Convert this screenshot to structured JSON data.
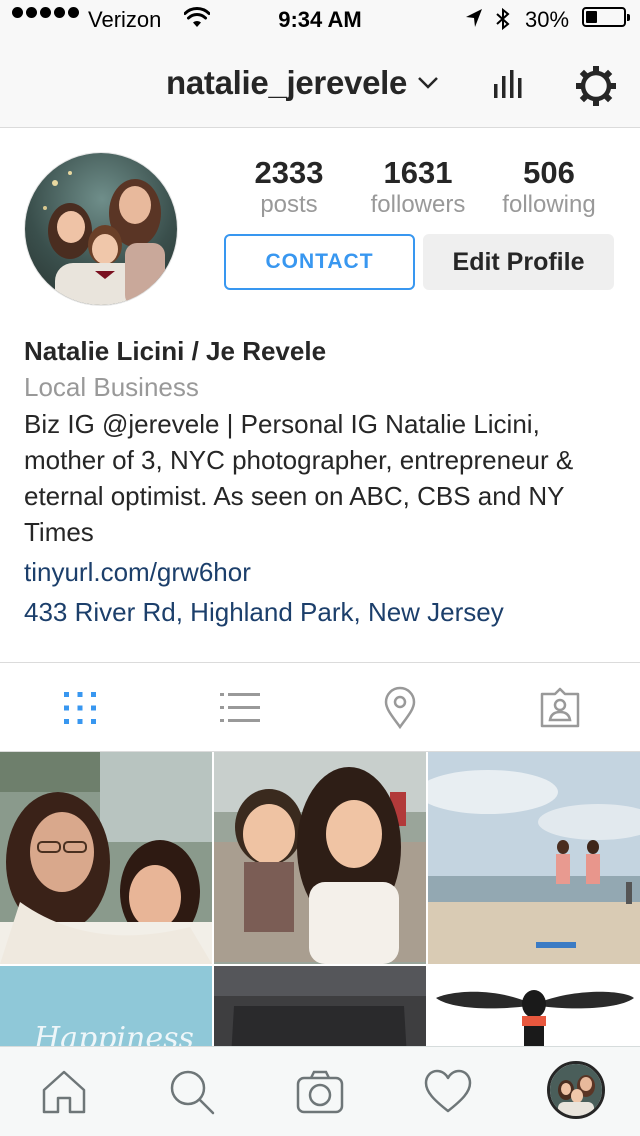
{
  "status_bar": {
    "carrier": "Verizon",
    "time": "9:34 AM",
    "battery": "30%",
    "battery_level": 0.3
  },
  "nav": {
    "username": "natalie_jerevele"
  },
  "profile": {
    "posts_count": "2333",
    "posts_label": "posts",
    "followers_count": "1631",
    "followers_label": "followers",
    "following_count": "506",
    "following_label": "following",
    "contact_label": "CONTACT",
    "edit_label": "Edit Profile",
    "full_name": "Natalie Licini / Je Revele",
    "category": "Local Business",
    "bio": "Biz IG @jerevele | Personal IG Natalie Licini, mother of 3, NYC photographer, entrepreneur & eternal optimist. As seen on ABC, CBS and NY Times",
    "link": "tinyurl.com/grw6hor",
    "address": "433 River Rd, Highland Park, New Jersey"
  },
  "tabs": [
    "grid-icon",
    "list-icon",
    "location-pin-icon",
    "tagged-photos-icon"
  ],
  "active_tab": "grid",
  "grid_tiles": 6,
  "bottom_bar": [
    "home-icon",
    "search-icon",
    "camera-icon",
    "heart-icon",
    "profile-avatar"
  ],
  "colors": {
    "accent_blue": "#3897f0",
    "link_navy": "#1c3f6b",
    "muted_gray": "#999999",
    "bar_bg": "#f8f8f8"
  }
}
